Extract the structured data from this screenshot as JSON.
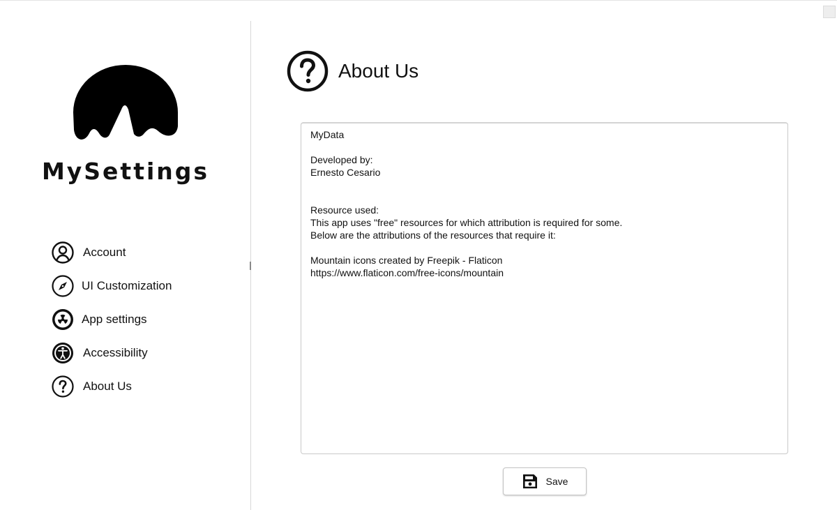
{
  "app": {
    "brand": "MySettings",
    "logo_icon": "mountain-icon"
  },
  "sidebar": {
    "items": [
      {
        "label": "Account",
        "icon": "user-circle-icon"
      },
      {
        "label": "UI Customization",
        "icon": "compass-icon"
      },
      {
        "label": "App settings",
        "icon": "radiation-icon"
      },
      {
        "label": "Accessibility",
        "icon": "accessibility-icon"
      },
      {
        "label": "About Us",
        "icon": "question-circle-icon"
      }
    ]
  },
  "header": {
    "title": "About Us",
    "icon": "question-circle-icon"
  },
  "about": {
    "lines": [
      "MyData",
      "",
      "Developed by:",
      "Ernesto Cesario",
      "",
      "",
      "Resource used:",
      "This app uses \"free\" resources for which attribution is required for some.",
      "Below are the attributions of the resources that require it:",
      "",
      "Mountain icons created by Freepik - Flaticon",
      "https://www.flaticon.com/free-icons/mountain"
    ]
  },
  "actions": {
    "save_label": "Save",
    "save_icon": "floppy-disk-icon"
  }
}
